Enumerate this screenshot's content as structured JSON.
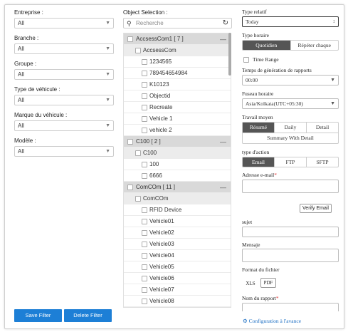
{
  "filters": [
    {
      "label": "Entreprise :",
      "value": "All"
    },
    {
      "label": "Branche :",
      "value": "All"
    },
    {
      "label": "Groupe :",
      "value": "All"
    },
    {
      "label": "Type de véhicule :",
      "value": "All"
    },
    {
      "label": "Marque du véhicule :",
      "value": "All"
    },
    {
      "label": "Modèle :",
      "value": "All"
    }
  ],
  "buttons": {
    "save": "Save Filter",
    "delete": "Delete Filter"
  },
  "objects": {
    "title": "Object Selection :",
    "search_placeholder": "Recherche",
    "groups": [
      {
        "label": "AccsessCom1 [ 7 ]",
        "sub": "AccsessCom",
        "items": [
          "1234565",
          "789454654984",
          "K10123",
          "Objectid",
          "Recreate",
          "Vehicle 1",
          "vehicle 2"
        ]
      },
      {
        "label": "C100 [ 2 ]",
        "sub": "C100",
        "items": [
          "100",
          "6666"
        ]
      },
      {
        "label": "ComCOm [ 11 ]",
        "sub": "ComCOm",
        "items": [
          "RFID Device",
          "Vehicle01",
          "Vehicle02",
          "Vehicle03",
          "Vehicle04",
          "Vehicle05",
          "Vehicle06",
          "Vehicle07",
          "Vehicle08"
        ]
      }
    ]
  },
  "report": {
    "type_label": "Type relatif",
    "type_value": "Today",
    "schedule_label": "Type horaire",
    "schedule_options": [
      "Quotidien",
      "Répéter chaque"
    ],
    "schedule_selected": 0,
    "time_range_label": "Time Range",
    "gen_time_label": "Temps de génération de rapports",
    "gen_time_value": "00:00",
    "timezone_label": "Fuseau horaire",
    "timezone_value": "Asia/Kolkata(UTC+05:30)",
    "travel_label": "Travail moyen",
    "travel_options": [
      "Résumé",
      "Daily",
      "Detail"
    ],
    "travel_selected": 0,
    "travel_extra": "Summary With Detail",
    "action_label": "type d'action",
    "action_options": [
      "Email",
      "FTP",
      "SFTP"
    ],
    "action_selected": 0,
    "email_label": "Adresse e-mail",
    "verify_label": "Verify Email",
    "subject_label": "sujet",
    "message_label": "Mensaje",
    "format_label": "Format du fichier",
    "formats": [
      "XLS",
      "PDF"
    ],
    "format_selected": 1,
    "report_name_label": "Nom du rapport",
    "advanced_label": "Configuration à l'avance",
    "required_mark": "*"
  }
}
